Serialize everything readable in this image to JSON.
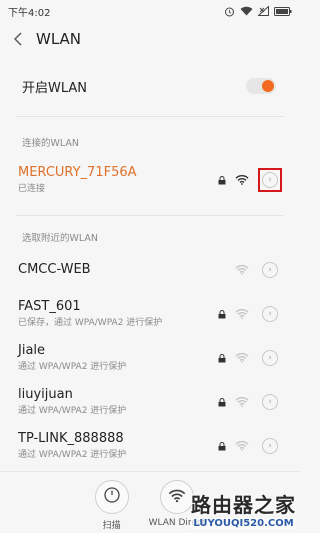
{
  "status_bar": {
    "time": "下午4:02",
    "icons": [
      "alarm-icon",
      "wifi-icon",
      "sim-x-icon",
      "battery-icon"
    ]
  },
  "header": {
    "title": "WLAN",
    "back_icon": "chevron-left-icon"
  },
  "toggle": {
    "label": "开启WLAN",
    "on": true,
    "accent": "#f36b20"
  },
  "connected_section": {
    "header": "连接的WLAN",
    "items": [
      {
        "name": "MERCURY_71F56A",
        "sub": "已连接",
        "locked": true,
        "highlight_detail": true,
        "name_color": "#e0712a"
      }
    ]
  },
  "nearby_section": {
    "header": "选取附近的WLAN",
    "items": [
      {
        "name": "CMCC-WEB",
        "sub": "",
        "locked": false
      },
      {
        "name": "FAST_601",
        "sub": "已保存，通过 WPA/WPA2 进行保护",
        "locked": true
      },
      {
        "name": "Jiale",
        "sub": "通过 WPA/WPA2 进行保护",
        "locked": true
      },
      {
        "name": "liuyijuan",
        "sub": "通过 WPA/WPA2 进行保护",
        "locked": true
      },
      {
        "name": "TP-LINK_888888",
        "sub": "通过 WPA/WPA2 进行保护",
        "locked": true
      }
    ]
  },
  "bottom_bar": {
    "scan": {
      "label": "扫描",
      "icon": "timer-icon"
    },
    "direct": {
      "label": "WLAN Direct",
      "icon": "wifi-icon"
    }
  },
  "watermark": {
    "title": "路由器之家",
    "url": "LUYOUQI520.COM"
  }
}
